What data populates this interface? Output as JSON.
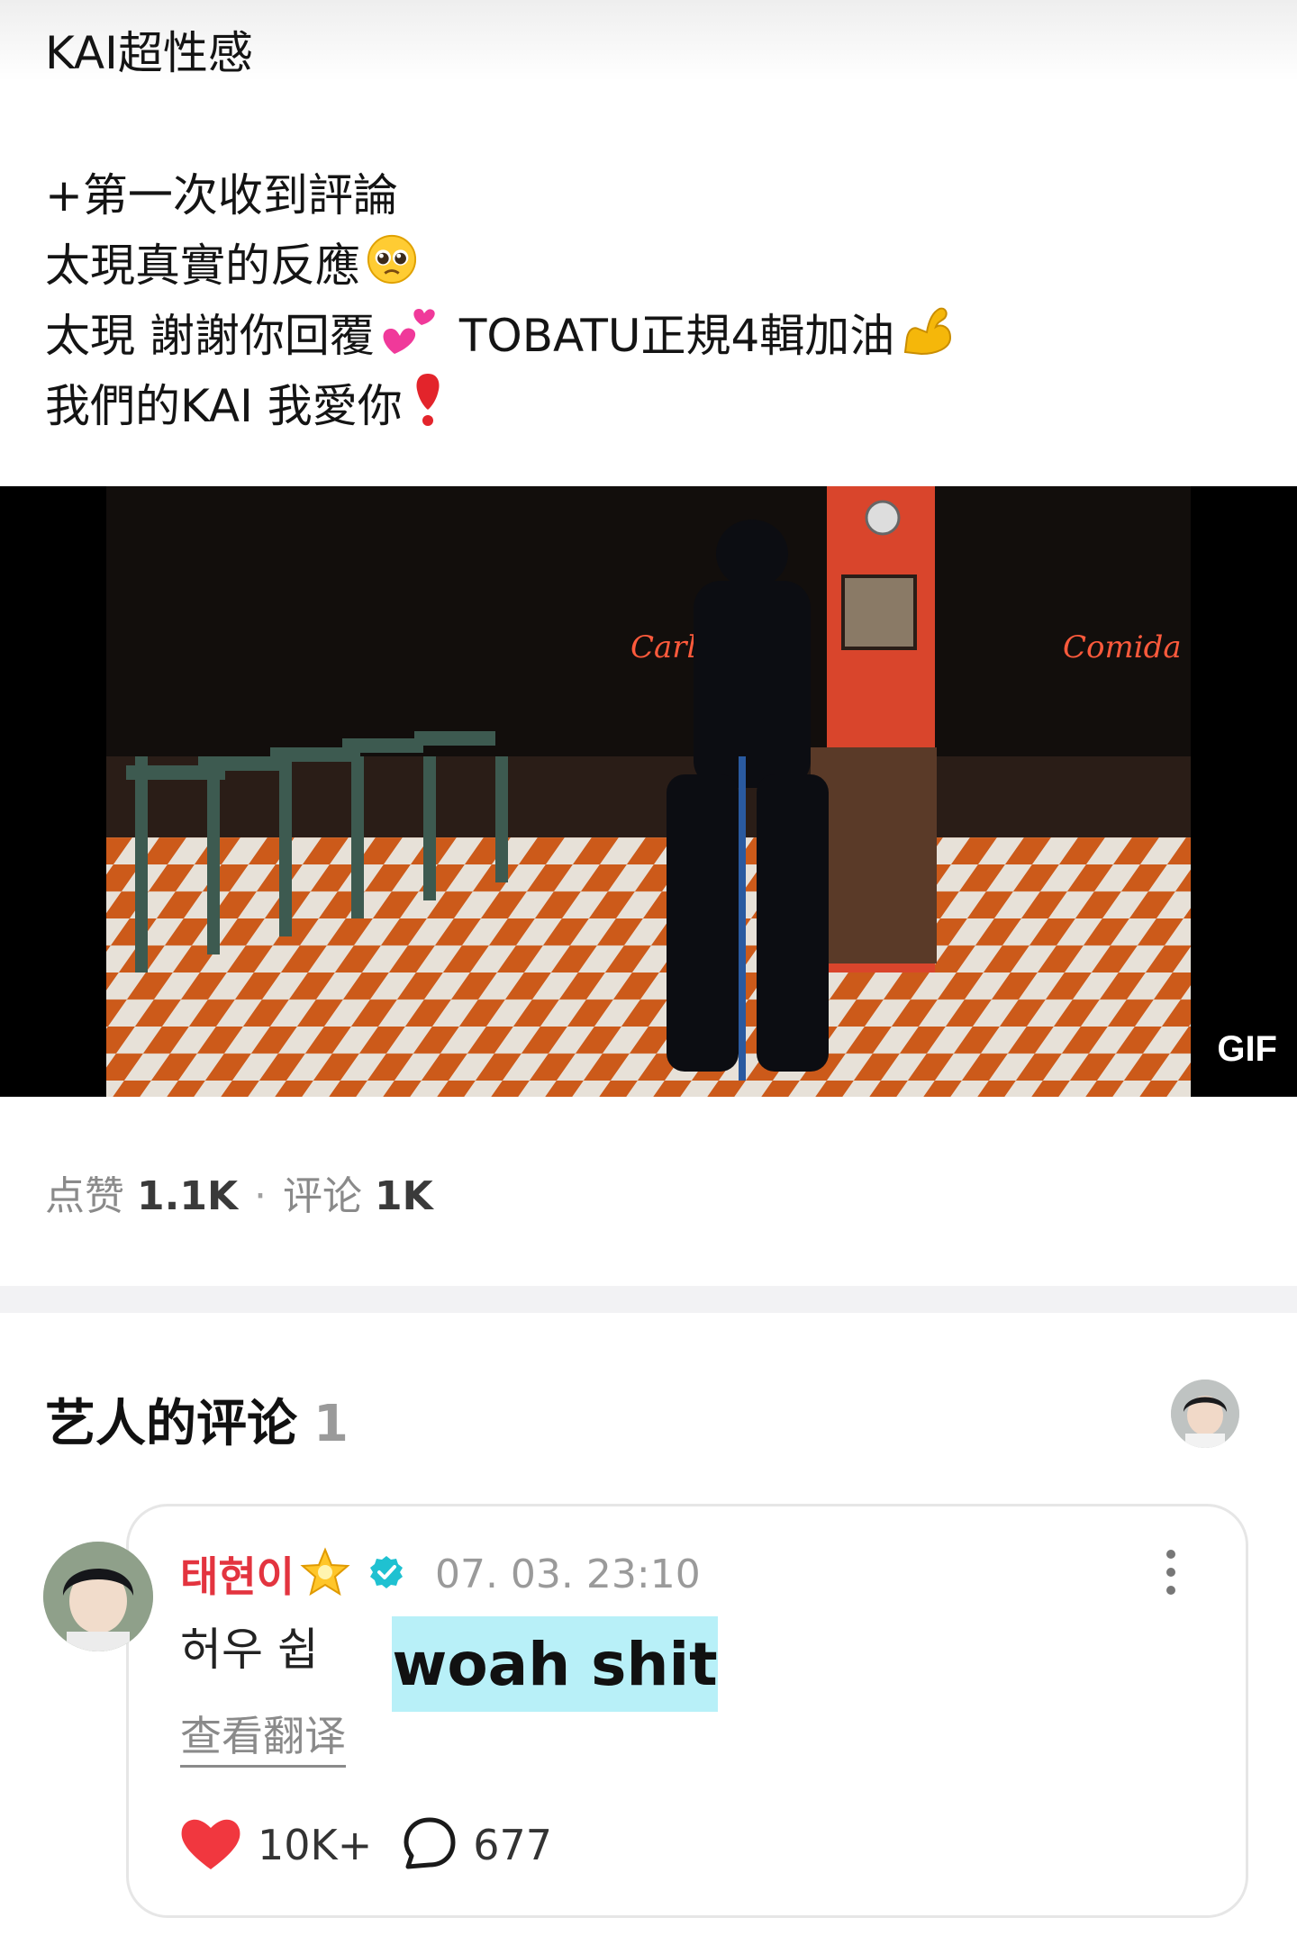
{
  "post": {
    "title_line": "KAI超性感",
    "body_lines": [
      "+第一次收到評論",
      "太現真實的反應",
      "太現 謝謝你回覆",
      "TOBATU正規4輯加油",
      "我們的KAI 我愛你"
    ],
    "emojis": [
      "pleading-face-emoji",
      "two-hearts-emoji",
      "flexed-biceps-emoji",
      "red-exclamation-emoji"
    ]
  },
  "media": {
    "badge": "GIF",
    "neon_sign_left": "Carlorita",
    "neon_sign_right": "Comida"
  },
  "stats": {
    "likes_label": "点赞",
    "likes_count": "1.1K",
    "separator": "·",
    "comments_label": "评论",
    "comments_count": "1K"
  },
  "artist_comments": {
    "title": "艺人的评论",
    "count": "1"
  },
  "comment": {
    "author": "태현이",
    "badge_icon": "glowing-star-emoji",
    "verified_icon": "verified-badge-icon",
    "date": "07. 03. 23:10",
    "text": "허우 쉽",
    "translation_overlay": "woah shit",
    "view_translation": "查看翻译",
    "likes": "10K+",
    "replies": "677"
  },
  "colors": {
    "username": "#e3343f",
    "heart": "#f1373f",
    "verified": "#1fc1d1",
    "highlight": "#b8f0f8"
  }
}
